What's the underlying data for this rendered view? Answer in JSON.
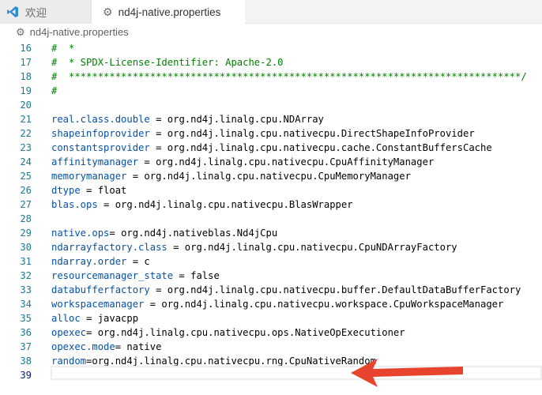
{
  "tabs": [
    {
      "label": "欢迎",
      "icon": "vscode-logo-icon",
      "active": false
    },
    {
      "label": "nd4j-native.properties",
      "icon": "gear-icon",
      "active": true
    }
  ],
  "breadcrumb": {
    "label": "nd4j-native.properties",
    "icon": "gear-icon"
  },
  "editor": {
    "lines": [
      {
        "n": "16",
        "type": "comment",
        "text": "#  *"
      },
      {
        "n": "17",
        "type": "comment",
        "text": "#  * SPDX-License-Identifier: Apache-2.0"
      },
      {
        "n": "18",
        "type": "comment",
        "text": "#  ******************************************************************************/"
      },
      {
        "n": "19",
        "type": "comment",
        "text": "#"
      },
      {
        "n": "20",
        "type": "blank",
        "text": ""
      },
      {
        "n": "21",
        "type": "prop",
        "key": "real.class.double",
        "sep": " = ",
        "value": "org.nd4j.linalg.cpu.NDArray"
      },
      {
        "n": "22",
        "type": "prop",
        "key": "shapeinfoprovider",
        "sep": " = ",
        "value": "org.nd4j.linalg.cpu.nativecpu.DirectShapeInfoProvider"
      },
      {
        "n": "23",
        "type": "prop",
        "key": "constantsprovider",
        "sep": " = ",
        "value": "org.nd4j.linalg.cpu.nativecpu.cache.ConstantBuffersCache"
      },
      {
        "n": "24",
        "type": "prop",
        "key": "affinitymanager",
        "sep": " = ",
        "value": "org.nd4j.linalg.cpu.nativecpu.CpuAffinityManager"
      },
      {
        "n": "25",
        "type": "prop",
        "key": "memorymanager",
        "sep": " = ",
        "value": "org.nd4j.linalg.cpu.nativecpu.CpuMemoryManager"
      },
      {
        "n": "26",
        "type": "prop",
        "key": "dtype",
        "sep": " = ",
        "value": "float"
      },
      {
        "n": "27",
        "type": "prop",
        "key": "blas.ops",
        "sep": " = ",
        "value": "org.nd4j.linalg.cpu.nativecpu.BlasWrapper"
      },
      {
        "n": "28",
        "type": "blank",
        "text": ""
      },
      {
        "n": "29",
        "type": "prop",
        "key": "native.ops",
        "sep": "= ",
        "value": "org.nd4j.nativeblas.Nd4jCpu"
      },
      {
        "n": "30",
        "type": "prop",
        "key": "ndarrayfactory.class",
        "sep": " = ",
        "value": "org.nd4j.linalg.cpu.nativecpu.CpuNDArrayFactory"
      },
      {
        "n": "31",
        "type": "prop",
        "key": "ndarray.order",
        "sep": " = ",
        "value": "c"
      },
      {
        "n": "32",
        "type": "prop",
        "key": "resourcemanager_state",
        "sep": " = ",
        "value": "false"
      },
      {
        "n": "33",
        "type": "prop",
        "key": "databufferfactory",
        "sep": " = ",
        "value": "org.nd4j.linalg.cpu.nativecpu.buffer.DefaultDataBufferFactory"
      },
      {
        "n": "34",
        "type": "prop",
        "key": "workspacemanager",
        "sep": " = ",
        "value": "org.nd4j.linalg.cpu.nativecpu.workspace.CpuWorkspaceManager"
      },
      {
        "n": "35",
        "type": "prop",
        "key": "alloc",
        "sep": " = ",
        "value": "javacpp"
      },
      {
        "n": "36",
        "type": "prop",
        "key": "opexec",
        "sep": "= ",
        "value": "org.nd4j.linalg.cpu.nativecpu.ops.NativeOpExecutioner"
      },
      {
        "n": "37",
        "type": "prop",
        "key": "opexec.mode",
        "sep": "= ",
        "value": "native"
      },
      {
        "n": "38",
        "type": "prop",
        "key": "random",
        "sep": "=",
        "value": "org.nd4j.linalg.cpu.nativecpu.rng.CpuNativeRandom"
      },
      {
        "n": "39",
        "type": "blank",
        "text": "",
        "current": true
      }
    ]
  },
  "colors": {
    "comment": "#008000",
    "key": "#0451a5",
    "line_number": "#237893",
    "arrow": "#e8442d"
  },
  "annotation": {
    "icon": "red-arrow-icon",
    "points_to_line": "39"
  }
}
